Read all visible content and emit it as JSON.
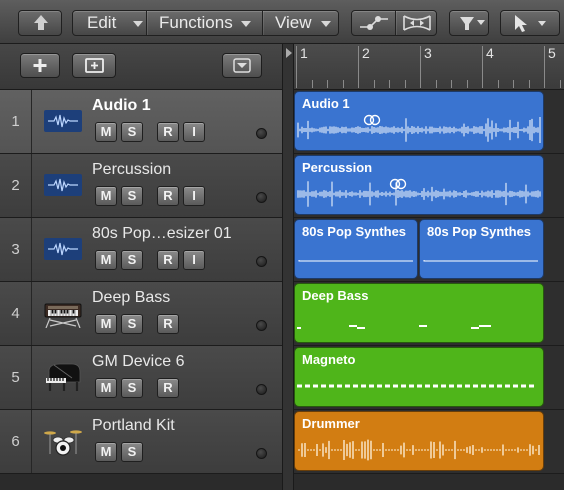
{
  "toolbar": {
    "menus": [
      {
        "label": "Edit"
      },
      {
        "label": "Functions"
      },
      {
        "label": "View"
      }
    ]
  },
  "ruler": {
    "bars": [
      "1",
      "2",
      "3",
      "4",
      "5"
    ]
  },
  "tracks": [
    {
      "number": "1",
      "name": "Audio 1",
      "buttons": [
        "M",
        "S",
        "R",
        "I"
      ],
      "icon": "audio-waveform-icon",
      "selected": true
    },
    {
      "number": "2",
      "name": "Percussion",
      "buttons": [
        "M",
        "S",
        "R",
        "I"
      ],
      "icon": "audio-waveform-icon"
    },
    {
      "number": "3",
      "name": "80s Pop…esizer 01",
      "buttons": [
        "M",
        "S",
        "R",
        "I"
      ],
      "icon": "audio-waveform-icon"
    },
    {
      "number": "4",
      "name": "Deep Bass",
      "buttons": [
        "M",
        "S",
        "R"
      ],
      "icon": "synthesizer-keyboard-icon"
    },
    {
      "number": "5",
      "name": "GM Device 6",
      "buttons": [
        "M",
        "S",
        "R"
      ],
      "icon": "grand-piano-icon"
    },
    {
      "number": "6",
      "name": "Portland Kit",
      "buttons": [
        "M",
        "S"
      ],
      "icon": "drum-kit-icon"
    }
  ],
  "regions": [
    {
      "name": "Audio 1",
      "color": "#3a74d0",
      "type": "audio",
      "loop": true
    },
    {
      "name": "Percussion",
      "color": "#3a74d0",
      "type": "audio",
      "loop": true
    },
    {
      "name": "80s Pop Synthes",
      "color": "#3a74d0",
      "type": "audio"
    },
    {
      "name": "80s Pop Synthes",
      "color": "#3a74d0",
      "type": "audio"
    },
    {
      "name": "Deep Bass",
      "color": "#4fb51a",
      "type": "midi"
    },
    {
      "name": "Magneto",
      "color": "#4fb51a",
      "type": "midi"
    },
    {
      "name": "Drummer",
      "color": "#d27d12",
      "type": "drummer"
    }
  ]
}
